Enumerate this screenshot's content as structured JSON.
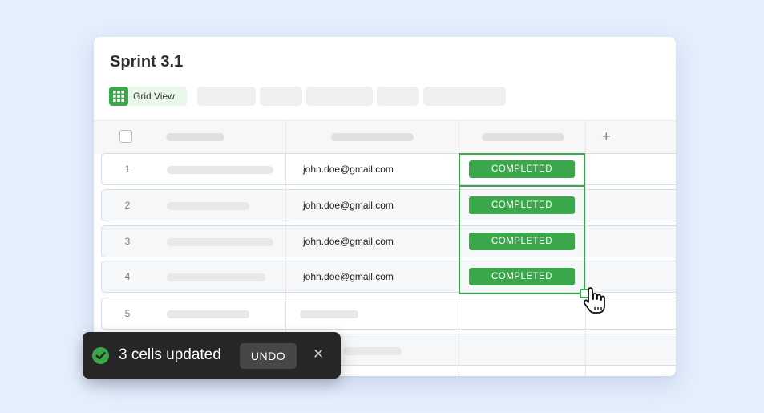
{
  "app": {
    "title": "Sprint 3.1",
    "active_view": "Grid View",
    "add_column_symbol": "+"
  },
  "table": {
    "rows": [
      {
        "number": "1",
        "email": "john.doe@gmail.com",
        "status": "COMPLETED"
      },
      {
        "number": "2",
        "email": "john.doe@gmail.com",
        "status": "COMPLETED"
      },
      {
        "number": "3",
        "email": "john.doe@gmail.com",
        "status": "COMPLETED"
      },
      {
        "number": "4",
        "email": "john.doe@gmail.com",
        "status": "COMPLETED"
      },
      {
        "number": "5",
        "email": "",
        "status": ""
      },
      {
        "number": "",
        "email": "",
        "status": ""
      }
    ]
  },
  "toast": {
    "message": "3 cells updated",
    "undo_label": "UNDO",
    "close_symbol": "✕"
  },
  "colors": {
    "accent": "#3aa84a",
    "toast_bg": "#262626",
    "page_bg": "#e4eefc"
  },
  "icons": [
    "grid-view-icon",
    "check-circle-icon",
    "close-icon",
    "hand-cursor-icon"
  ]
}
